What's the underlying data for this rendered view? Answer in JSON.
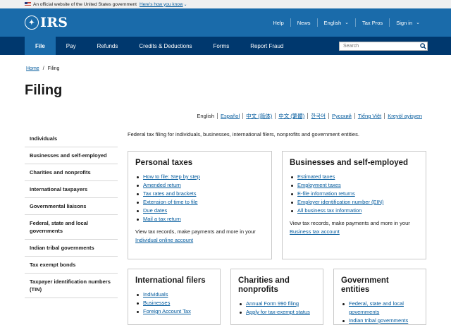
{
  "banner": {
    "text": "An official website of the United States government",
    "link": "Here's how you know"
  },
  "header": {
    "logo": "IRS",
    "links": [
      {
        "label": "Help",
        "caret": false
      },
      {
        "label": "News",
        "caret": false
      },
      {
        "label": "English",
        "caret": true
      },
      {
        "label": "Tax Pros",
        "caret": false
      },
      {
        "label": "Sign in",
        "caret": true
      }
    ]
  },
  "nav": {
    "items": [
      "File",
      "Pay",
      "Refunds",
      "Credits & Deductions",
      "Forms",
      "Report Fraud"
    ],
    "active": "File",
    "search_placeholder": "Search"
  },
  "breadcrumb": {
    "home": "Home",
    "separator": "/",
    "current": "Filing"
  },
  "page_title": "Filing",
  "languages": [
    "English",
    "Español",
    "中文 (简体)",
    "中文 (繁體)",
    "한국어",
    "Русский",
    "Tiếng Việt",
    "Kreyòl ayisyen"
  ],
  "sidebar": [
    "Individuals",
    "Businesses and self-employed",
    "Charities and nonprofits",
    "International taxpayers",
    "Governmental liaisons",
    "Federal, state and local governments",
    "Indian tribal governments",
    "Tax exempt bonds",
    "Taxpayer identification numbers (TIN)"
  ],
  "intro": "Federal tax filing for individuals, businesses, international filers, nonprofits and government entities.",
  "cards": {
    "personal": {
      "title": "Personal taxes",
      "links": [
        "How to file: Step by step",
        "Amended return",
        "Tax rates and brackets",
        "Extension of time to file",
        "Due dates",
        "Mail a tax return"
      ],
      "note": "View tax records, make payments and more in your",
      "note_link": "Individual online account"
    },
    "business": {
      "title": "Businesses and self-employed",
      "links": [
        "Estimated taxes",
        "Employment taxes",
        "E-file information returns",
        "Employer identification number (EIN)",
        "All business tax information"
      ],
      "note": "View tax records, make payments and more in your",
      "note_link": "Business tax account"
    },
    "international": {
      "title": "International filers",
      "links": [
        "Individuals",
        "Businesses",
        "Foreign Account Tax"
      ]
    },
    "charities": {
      "title": "Charities and nonprofits",
      "links": [
        "Annual Form 990 filing",
        "Apply for tax-exempt status"
      ]
    },
    "government": {
      "title": "Government entities",
      "links": [
        "Federal, state and local governments",
        "Indian tribal governments"
      ]
    }
  }
}
